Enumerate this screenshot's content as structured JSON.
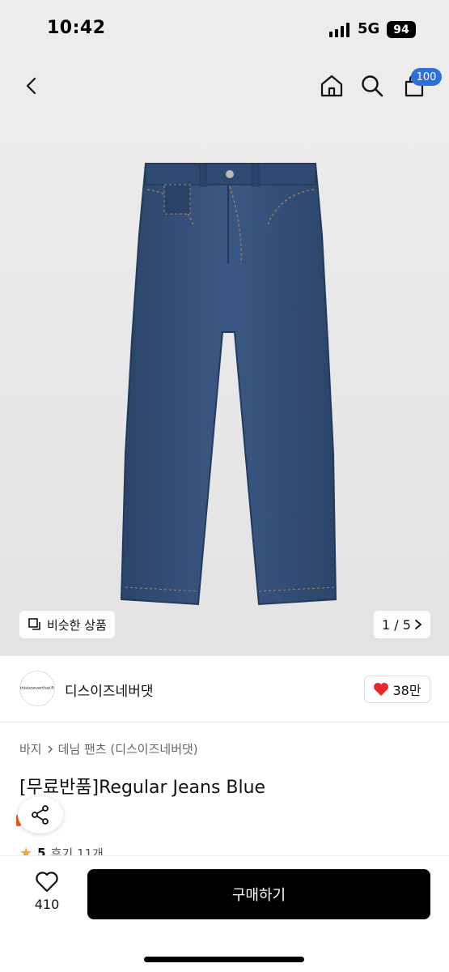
{
  "status_bar": {
    "time": "10:42",
    "network": "5G",
    "battery": "94"
  },
  "nav": {
    "cart_count": "100"
  },
  "hero": {
    "similar_label": "비슷한 상품",
    "page_current": "1",
    "page_total": "5",
    "page_text": "1 / 5"
  },
  "store": {
    "logo_text": "thisisneverthat®",
    "name": "디스이즈네버댓",
    "likes": "38만"
  },
  "product": {
    "breadcrumb": [
      "바지",
      "데님 팬츠 (디스이즈네버댓)"
    ],
    "title": "[무료반품]Regular Jeans Blue",
    "rating": "5",
    "reviews": "후기 11개"
  },
  "bottom": {
    "wish_count": "410",
    "buy_label": "구매하기"
  },
  "colors": {
    "accent_badge": "#2e6fde",
    "heart": "#e8262b",
    "buy_button": "#000000",
    "denim": "#34507a"
  }
}
